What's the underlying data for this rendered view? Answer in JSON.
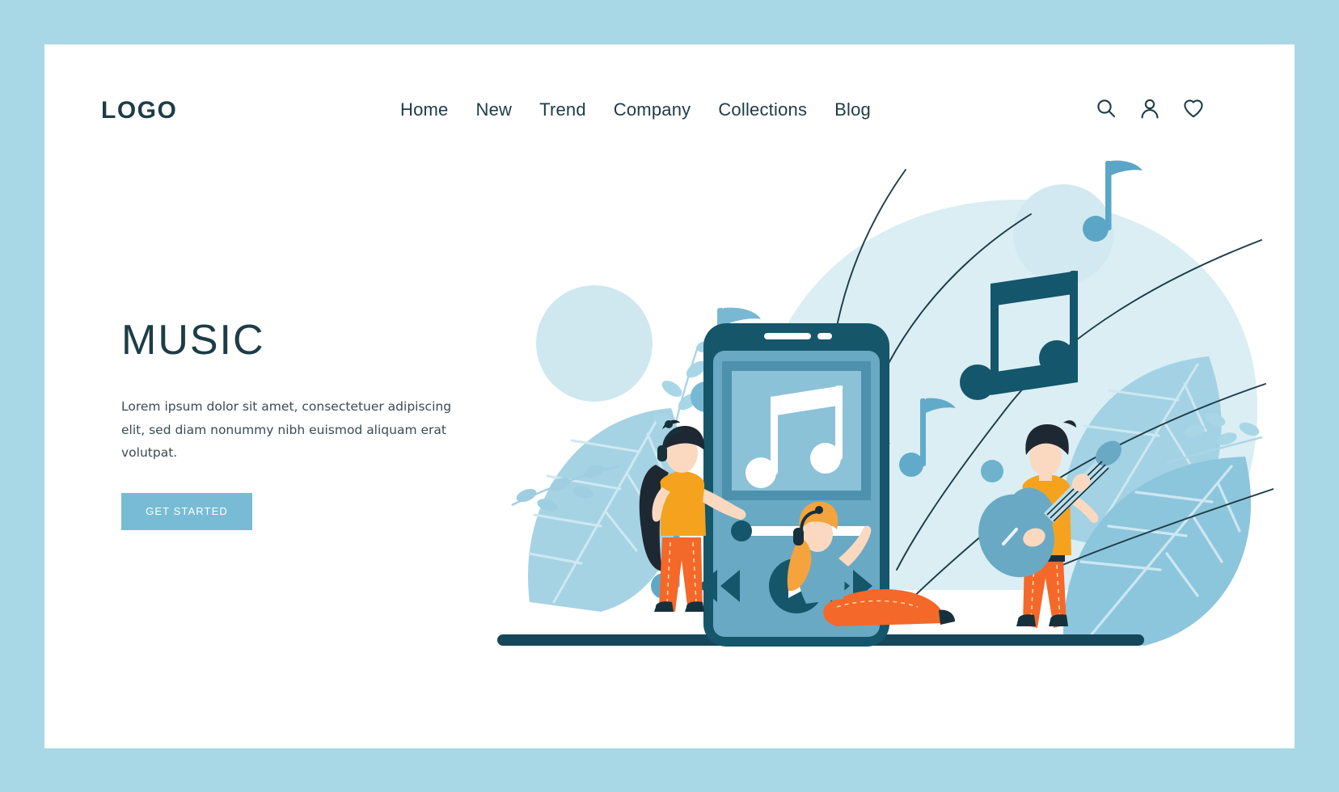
{
  "brand": {
    "logo": "LOGO"
  },
  "nav": {
    "items": [
      {
        "label": "Home"
      },
      {
        "label": "New"
      },
      {
        "label": "Trend"
      },
      {
        "label": "Company"
      },
      {
        "label": "Collections"
      },
      {
        "label": "Blog"
      }
    ]
  },
  "header_icons": [
    {
      "name": "search-icon"
    },
    {
      "name": "user-icon"
    },
    {
      "name": "heart-icon"
    }
  ],
  "hero": {
    "title": "MUSIC",
    "paragraph": "Lorem ipsum dolor sit amet, consectetuer adipiscing elit, sed diam nonummy nibh euismod aliquam erat volutpat.",
    "cta_label": "GET STARTED"
  },
  "illustration": {
    "alt": "music-app-illustration",
    "phone": {
      "album_art_icon": "beamed-music-note",
      "progress_percent": 18,
      "controls": [
        "rewind",
        "play",
        "forward"
      ]
    },
    "characters": [
      {
        "name": "standing-woman-with-headphones"
      },
      {
        "name": "seated-woman-with-headphones"
      },
      {
        "name": "man-playing-guitar"
      }
    ],
    "decor": [
      "music-notes",
      "sound-wave-lines",
      "leaves",
      "circles",
      "blob-background"
    ]
  },
  "colors": {
    "page_border": "#a8d8e5",
    "card": "#ffffff",
    "dark_teal": "#1d3c47",
    "accent_blue": "#77bcd4",
    "mid_blue": "#6aa9c4",
    "light_blue": "#d9edf3",
    "pale_blue": "#c3e2ec",
    "orange": "#f4682a",
    "amber": "#f5a31e",
    "skin": "#fbd9c0"
  }
}
